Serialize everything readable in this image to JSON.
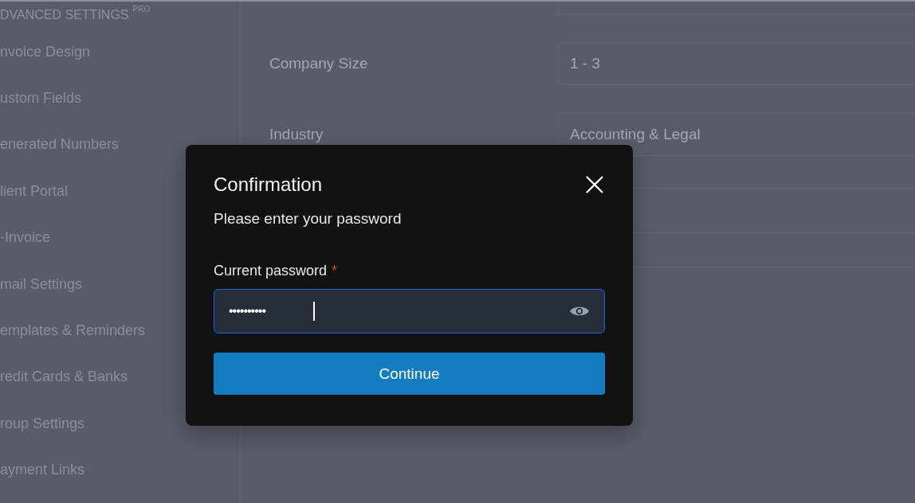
{
  "sidebar": {
    "heading": "DVANCED SETTINGS",
    "badge": "PRO",
    "items": [
      {
        "label": "nvoice Design"
      },
      {
        "label": "ustom Fields"
      },
      {
        "label": "enerated Numbers"
      },
      {
        "label": "lient Portal"
      },
      {
        "label": "-Invoice"
      },
      {
        "label": "mail Settings"
      },
      {
        "label": "emplates & Reminders"
      },
      {
        "label": "redit Cards & Banks"
      },
      {
        "label": "roup Settings"
      },
      {
        "label": "ayment Links"
      }
    ]
  },
  "form": {
    "rows": [
      {
        "label": "Company Size",
        "value": "1 - 3"
      },
      {
        "label": "Industry",
        "value": "Accounting & Legal"
      }
    ]
  },
  "dialog": {
    "title": "Confirmation",
    "subtitle": "Please enter your password",
    "field_label": "Current password",
    "required_mark": "*",
    "password": {
      "value": "••••••••••",
      "focused": true
    },
    "button": "Continue"
  }
}
